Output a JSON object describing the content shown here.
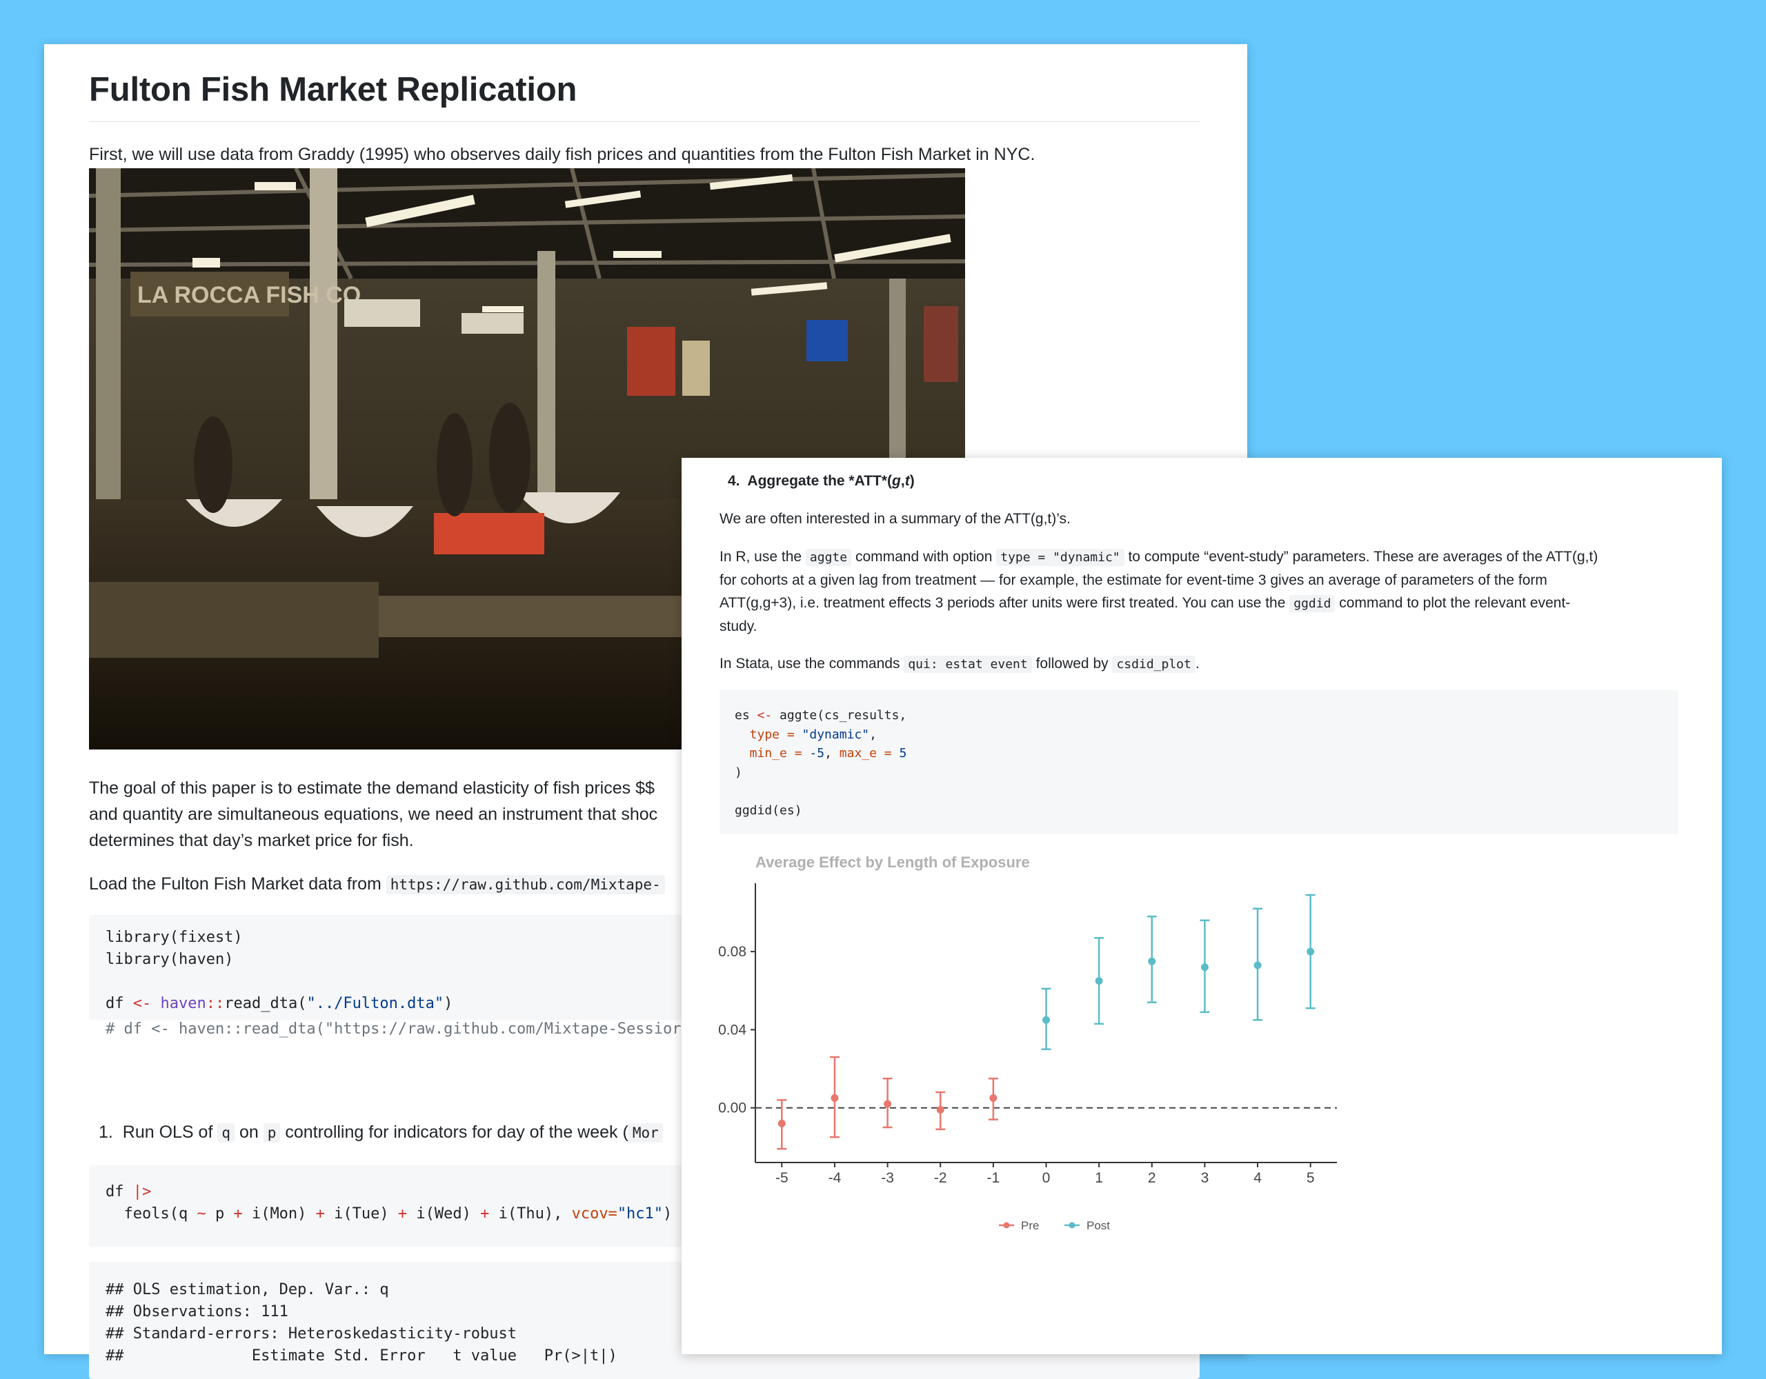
{
  "back_doc": {
    "title": "Fulton Fish Market Replication",
    "intro": "First, we will use data from Graddy (1995) who observes daily fish prices and quantities from the Fulton Fish Market in NYC.",
    "photo_alt": "Fulton Fish Market interior photo",
    "photo_sign_text": "LA ROCCA FISH CO",
    "goal_lines": [
      "The goal of this paper is to estimate the demand elasticity of fish prices $$",
      "and quantity are simultaneous equations, we need an instrument that shoc",
      "determines that day’s market price for fish."
    ],
    "load_text": "Load the Fulton Fish Market data from",
    "load_url": "https://raw.github.com/Mixtape-",
    "code1": {
      "l1": "library(fixest)",
      "l2": "library(haven)",
      "l4a": "df ",
      "l4b": "<-",
      "l4c": " haven",
      "l4d": "::",
      "l4e": "read_dta(",
      "l4f": "\"../Fulton.dta\"",
      "l4g": ")",
      "l5": "# df <- haven::read_dta(\"https://raw.github.com/Mixtape-Sessior"
    },
    "step1": {
      "num": "1.",
      "t1": "Run OLS of",
      "c1": "q",
      "t2": "on",
      "c2": "p",
      "t3": "controlling for indicators for day of the week (",
      "c3": "Mor"
    },
    "code2": {
      "l1a": "df ",
      "l1b": "|>",
      "l2a": "  feols(q ",
      "l2b": "~",
      "l2c": " p ",
      "l2d": "+",
      "l2e": " i(Mon) ",
      "l2f": "+",
      "l2g": " i(Tue) ",
      "l2h": "+",
      "l2i": " i(Wed) ",
      "l2j": "+",
      "l2k": " i(Thu), ",
      "l2l": "vcov=",
      "l2m": "\"hc1\"",
      "l2n": ")"
    },
    "output": [
      "## OLS estimation, Dep. Var.: q",
      "## Observations: 111",
      "## Standard-errors: Heteroskedasticity-robust",
      "##              Estimate Std. Error   t value   Pr(>|t|)"
    ]
  },
  "front_doc": {
    "step4_num": "4.",
    "step4_text": "Aggregate the *ATT*(",
    "step4_g": "g",
    "step4_comma": ",",
    "step4_t": "t",
    "step4_close": ")",
    "p1": "We are often interested in a summary of the ATT(g,t)’s.",
    "p2": {
      "a": "In R, use the",
      "c1": "aggte",
      "b": "command with option",
      "c2": "type = \"dynamic\"",
      "c": "to compute “event-study” parameters. These are averages of the ATT(g,t)",
      "line2": "for cohorts at a given lag from treatment — for example, the estimate for event-time 3 gives an average of parameters of the form",
      "line3a": "ATT(g,g+3), i.e. treatment effects 3 periods after units were first treated. You can use the",
      "c3": "ggdid",
      "line3b": "command to plot the relevant event-",
      "line4": "study."
    },
    "p3": {
      "a": "In Stata, use the commands",
      "c1": "qui: estat event",
      "b": "followed by",
      "c2": "csdid_plot",
      "c": "."
    },
    "code": {
      "l1a": "es ",
      "l1b": "<-",
      "l1c": " aggte(cs_results,",
      "l2a": "  type ",
      "l2b": "=",
      "l2c": " ",
      "l2d": "\"dynamic\"",
      "l2e": ",",
      "l3a": "  min_e ",
      "l3b": "=",
      "l3c": " ",
      "l3d": "-5",
      "l3e": ", ",
      "l3f": "max_e ",
      "l3g": "=",
      "l3h": " ",
      "l3i": "5",
      "l4": ")",
      "l6": "ggdid(es)"
    }
  },
  "chart_data": {
    "type": "scatter",
    "title": "Average Effect by Length of Exposure",
    "xlabel": "",
    "ylabel": "",
    "x_ticks": [
      "-5",
      "-4",
      "-3",
      "-2",
      "-1",
      "0",
      "1",
      "2",
      "3",
      "4",
      "5"
    ],
    "y_ticks": [
      "0.00",
      "0.04",
      "0.08"
    ],
    "xlim": [
      -5.5,
      5.5
    ],
    "ylim": [
      -0.028,
      0.115
    ],
    "reference_line": 0,
    "legend_position": "bottom",
    "colors": {
      "Pre": "#e8776e",
      "Post": "#5bbcc8"
    },
    "series": [
      {
        "name": "Pre",
        "points": [
          {
            "x": -5,
            "y": -0.008,
            "lo": -0.021,
            "hi": 0.004
          },
          {
            "x": -4,
            "y": 0.005,
            "lo": -0.015,
            "hi": 0.026
          },
          {
            "x": -3,
            "y": 0.002,
            "lo": -0.01,
            "hi": 0.015
          },
          {
            "x": -2,
            "y": -0.001,
            "lo": -0.011,
            "hi": 0.008
          },
          {
            "x": -1,
            "y": 0.005,
            "lo": -0.006,
            "hi": 0.015
          }
        ]
      },
      {
        "name": "Post",
        "points": [
          {
            "x": 0,
            "y": 0.045,
            "lo": 0.03,
            "hi": 0.061
          },
          {
            "x": 1,
            "y": 0.065,
            "lo": 0.043,
            "hi": 0.087
          },
          {
            "x": 2,
            "y": 0.075,
            "lo": 0.054,
            "hi": 0.098
          },
          {
            "x": 3,
            "y": 0.072,
            "lo": 0.049,
            "hi": 0.096
          },
          {
            "x": 4,
            "y": 0.073,
            "lo": 0.045,
            "hi": 0.102
          },
          {
            "x": 5,
            "y": 0.08,
            "lo": 0.051,
            "hi": 0.109
          }
        ]
      }
    ]
  }
}
